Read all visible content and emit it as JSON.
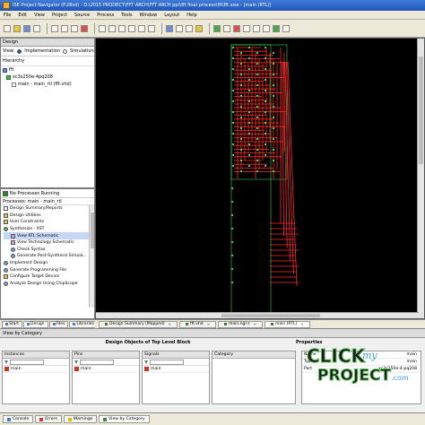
{
  "window": {
    "title": "ISE Project Navigator (P.28xd) - D:\\2015 PRODECT\\FFT ARCH\\FFT ARCH ppt\\fft final process\\fft\\fft.xise - [main (RTL)]"
  },
  "menu": [
    "File",
    "Edit",
    "View",
    "Project",
    "Source",
    "Process",
    "Tools",
    "Window",
    "Layout",
    "Help"
  ],
  "design_panel": {
    "header": "Design",
    "view_label": "View:",
    "views": [
      "Implementation",
      "Simulation"
    ],
    "hierarchy_label": "Hierarchy",
    "tree": [
      {
        "label": "fft",
        "icon": "project-icon"
      },
      {
        "label": "xc3s250e-4pq208",
        "icon": "chip-icon"
      },
      {
        "label": "main - main_rtl (fft.vhd)",
        "icon": "file-icon"
      }
    ]
  },
  "process_panel": {
    "status": "No Processes Running",
    "for_label": "Processes: main - main_rtl",
    "items": [
      {
        "label": "Design Summary/Reports",
        "icon": "doc",
        "indent": false
      },
      {
        "label": "Design Utilities",
        "icon": "folder",
        "indent": false
      },
      {
        "label": "User Constraints",
        "icon": "folder",
        "indent": false
      },
      {
        "label": "Synthesize - XST",
        "icon": "ok",
        "indent": false
      },
      {
        "label": "View RTL Schematic",
        "icon": "sch",
        "indent": true,
        "selected": true
      },
      {
        "label": "View Technology Schematic",
        "icon": "sch",
        "indent": true
      },
      {
        "label": "Check Syntax",
        "icon": "gear",
        "indent": true
      },
      {
        "label": "Generate Post-Synthesis Simula...",
        "icon": "gear",
        "indent": true
      },
      {
        "label": "Implement Design",
        "icon": "gear",
        "indent": false
      },
      {
        "label": "Generate Programming File",
        "icon": "gear",
        "indent": false
      },
      {
        "label": "Configure Target Device",
        "icon": "folder",
        "indent": false
      },
      {
        "label": "Analyze Design Using ChipScope",
        "icon": "gear",
        "indent": false
      }
    ]
  },
  "left_tabs": [
    "Start",
    "Design",
    "Files",
    "Libraries"
  ],
  "doc_tabs": [
    {
      "label": "Design Summary (Mapped)",
      "active": false
    },
    {
      "label": "fft.vhd",
      "active": false
    },
    {
      "label": "main.ngr.s",
      "active": false
    },
    {
      "label": "main (RTL)",
      "active": true
    }
  ],
  "schematic": {
    "wire_color": "#ff2a2a",
    "pin_color": "#3fd03f",
    "border_color": "#3fd03f"
  },
  "bottom_panel": {
    "header": "View by Category",
    "section_title": "Design Objects of Top Level Block",
    "properties_title": "Properties",
    "columns": [
      {
        "name": "Instances",
        "rows": [
          "main"
        ]
      },
      {
        "name": "Pins",
        "rows": [
          "main"
        ]
      },
      {
        "name": "Signals",
        "rows": [
          "main"
        ]
      },
      {
        "name": "Category",
        "rows": []
      }
    ],
    "properties": [
      {
        "key": "Name",
        "value": "main"
      },
      {
        "key": "Type",
        "value": "main"
      },
      {
        "key": "Part",
        "value": "xc3s250e-4-pq208"
      }
    ]
  },
  "status_tabs": [
    "Console",
    "Errors",
    "Warnings",
    "View by Category"
  ],
  "watermark": {
    "line1": "CLICK",
    "line2": "my",
    "line3": "PROJECT",
    "suffix": ".com"
  }
}
